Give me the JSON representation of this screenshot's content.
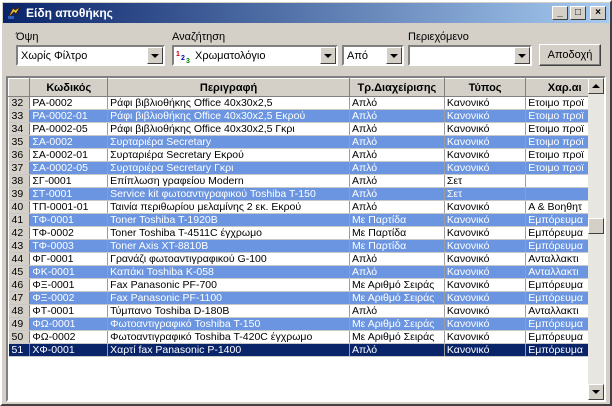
{
  "window": {
    "title": "Είδη αποθήκης",
    "min": "_",
    "max": "□",
    "close": "×"
  },
  "filters": {
    "view_label": "Όψη",
    "view_value": "Χωρίς Φίλτρο",
    "search_label": "Αναζήτηση",
    "search_value": "Χρωματολόγιο",
    "from_value": "Από",
    "content_label": "Περιεχόμενο",
    "content_value": "",
    "accept_label": "Αποδοχή"
  },
  "columns": [
    "",
    "Κωδικός",
    "Περιγραφή",
    "Τρ.Διαχείρισης",
    "Τύπος",
    "Χαρ.αι"
  ],
  "rows": [
    {
      "n": "32",
      "code": "ΡΑ-0002",
      "desc": "Ράφι βιβλιοθήκης Office 40x30x2,5",
      "mgmt": "Απλό",
      "type": "Κανονικό",
      "char": "Ετοιμο προϊ",
      "style": "norm"
    },
    {
      "n": "33",
      "code": "ΡΑ-0002-01",
      "desc": "Ράφι βιβλιοθήκης Office 40x30x2,5 Εκρού",
      "mgmt": "Απλό",
      "type": "Κανονικό",
      "char": "Ετοιμο προϊ",
      "style": "alt"
    },
    {
      "n": "34",
      "code": "ΡΑ-0002-05",
      "desc": "Ράφι βιβλιοθήκης Office 40x30x2,5 Γκρι",
      "mgmt": "Απλό",
      "type": "Κανονικό",
      "char": "Ετοιμο προϊ",
      "style": "norm"
    },
    {
      "n": "35",
      "code": "ΣΑ-0002",
      "desc": "Συρταριέρα Secretary",
      "mgmt": "Απλό",
      "type": "Κανονικό",
      "char": "Ετοιμο προϊ",
      "style": "alt"
    },
    {
      "n": "36",
      "code": "ΣΑ-0002-01",
      "desc": "Συρταριέρα Secretary Εκρού",
      "mgmt": "Απλό",
      "type": "Κανονικό",
      "char": "Ετοιμο προϊ",
      "style": "norm"
    },
    {
      "n": "37",
      "code": "ΣΑ-0002-05",
      "desc": "Συρταριέρα Secretary Γκρι",
      "mgmt": "Απλό",
      "type": "Κανονικό",
      "char": "Ετοιμο προϊ",
      "style": "alt"
    },
    {
      "n": "38",
      "code": "ΣΓ-0001",
      "desc": "Επίπλωση γραφείου Modern",
      "mgmt": "Απλό",
      "type": "Σετ",
      "char": "",
      "style": "norm"
    },
    {
      "n": "39",
      "code": "ΣΤ-0001",
      "desc": "Service kit φωτοαντιγραφικού Toshiba T-150",
      "mgmt": "Απλό",
      "type": "Σετ",
      "char": "",
      "style": "alt"
    },
    {
      "n": "40",
      "code": "ΤΠ-0001-01",
      "desc": "Ταινία περιθωρίου μελαμίνης 2 εκ. Εκρού",
      "mgmt": "Απλό",
      "type": "Κανονικό",
      "char": "Α & Βοηθητ",
      "style": "norm"
    },
    {
      "n": "41",
      "code": "ΤΦ-0001",
      "desc": "Toner Toshiba T-1920B",
      "mgmt": "Με Παρτίδα",
      "type": "Κανονικό",
      "char": "Εμπόρευμα",
      "style": "alt"
    },
    {
      "n": "42",
      "code": "ΤΦ-0002",
      "desc": "Toner Toshiba T-4511C έγχρωμο",
      "mgmt": "Με Παρτίδα",
      "type": "Κανονικό",
      "char": "Εμπόρευμα",
      "style": "norm"
    },
    {
      "n": "43",
      "code": "ΤΦ-0003",
      "desc": "Toner Axis XT-8810B",
      "mgmt": "Με Παρτίδα",
      "type": "Κανονικό",
      "char": "Εμπόρευμα",
      "style": "alt"
    },
    {
      "n": "44",
      "code": "ΦΓ-0001",
      "desc": "Γρανάζι φωτοαντιγραφικού G-100",
      "mgmt": "Απλό",
      "type": "Κανονικό",
      "char": "Ανταλλακτι",
      "style": "norm"
    },
    {
      "n": "45",
      "code": "ΦΚ-0001",
      "desc": "Καπάκι Toshiba K-058",
      "mgmt": "Απλό",
      "type": "Κανονικό",
      "char": "Ανταλλακτι",
      "style": "alt"
    },
    {
      "n": "46",
      "code": "ΦΞ-0001",
      "desc": "Fax Panasonic PF-700",
      "mgmt": "Με Αριθμό Σειράς",
      "type": "Κανονικό",
      "char": "Εμπόρευμα",
      "style": "norm"
    },
    {
      "n": "47",
      "code": "ΦΞ-0002",
      "desc": "Fax Panasonic PF-1100",
      "mgmt": "Με Αριθμό Σειράς",
      "type": "Κανονικό",
      "char": "Εμπόρευμα",
      "style": "alt"
    },
    {
      "n": "48",
      "code": "ΦΤ-0001",
      "desc": "Τύμπανο Toshiba D-180B",
      "mgmt": "Απλό",
      "type": "Κανονικό",
      "char": "Ανταλλακτι",
      "style": "norm"
    },
    {
      "n": "49",
      "code": "ΦΩ-0001",
      "desc": "Φωτοαντιγραφικό Toshiba T-150",
      "mgmt": "Με Αριθμό Σειράς",
      "type": "Κανονικό",
      "char": "Εμπόρευμα",
      "style": "alt"
    },
    {
      "n": "50",
      "code": "ΦΩ-0002",
      "desc": "Φωτοαντιγραφικό Toshiba T-420C έγχρωμο",
      "mgmt": "Με Αριθμό Σειράς",
      "type": "Κανονικό",
      "char": "Εμπόρευμα",
      "style": "norm"
    },
    {
      "n": "51",
      "code": "ΧΦ-0001",
      "desc": "Χαρτί fax Panasonic P-1400",
      "mgmt": "Απλό",
      "type": "Κανονικό",
      "char": "Εμπόρευμα",
      "style": "sel"
    }
  ],
  "colors": {
    "title_start": "#0a246a",
    "title_end": "#a6caf0",
    "alt_row": "#6b95e0",
    "selected_row": "#0a246a"
  },
  "icons": {
    "app": "warehouse-app-icon",
    "search_mode": "sort-123-icon"
  }
}
